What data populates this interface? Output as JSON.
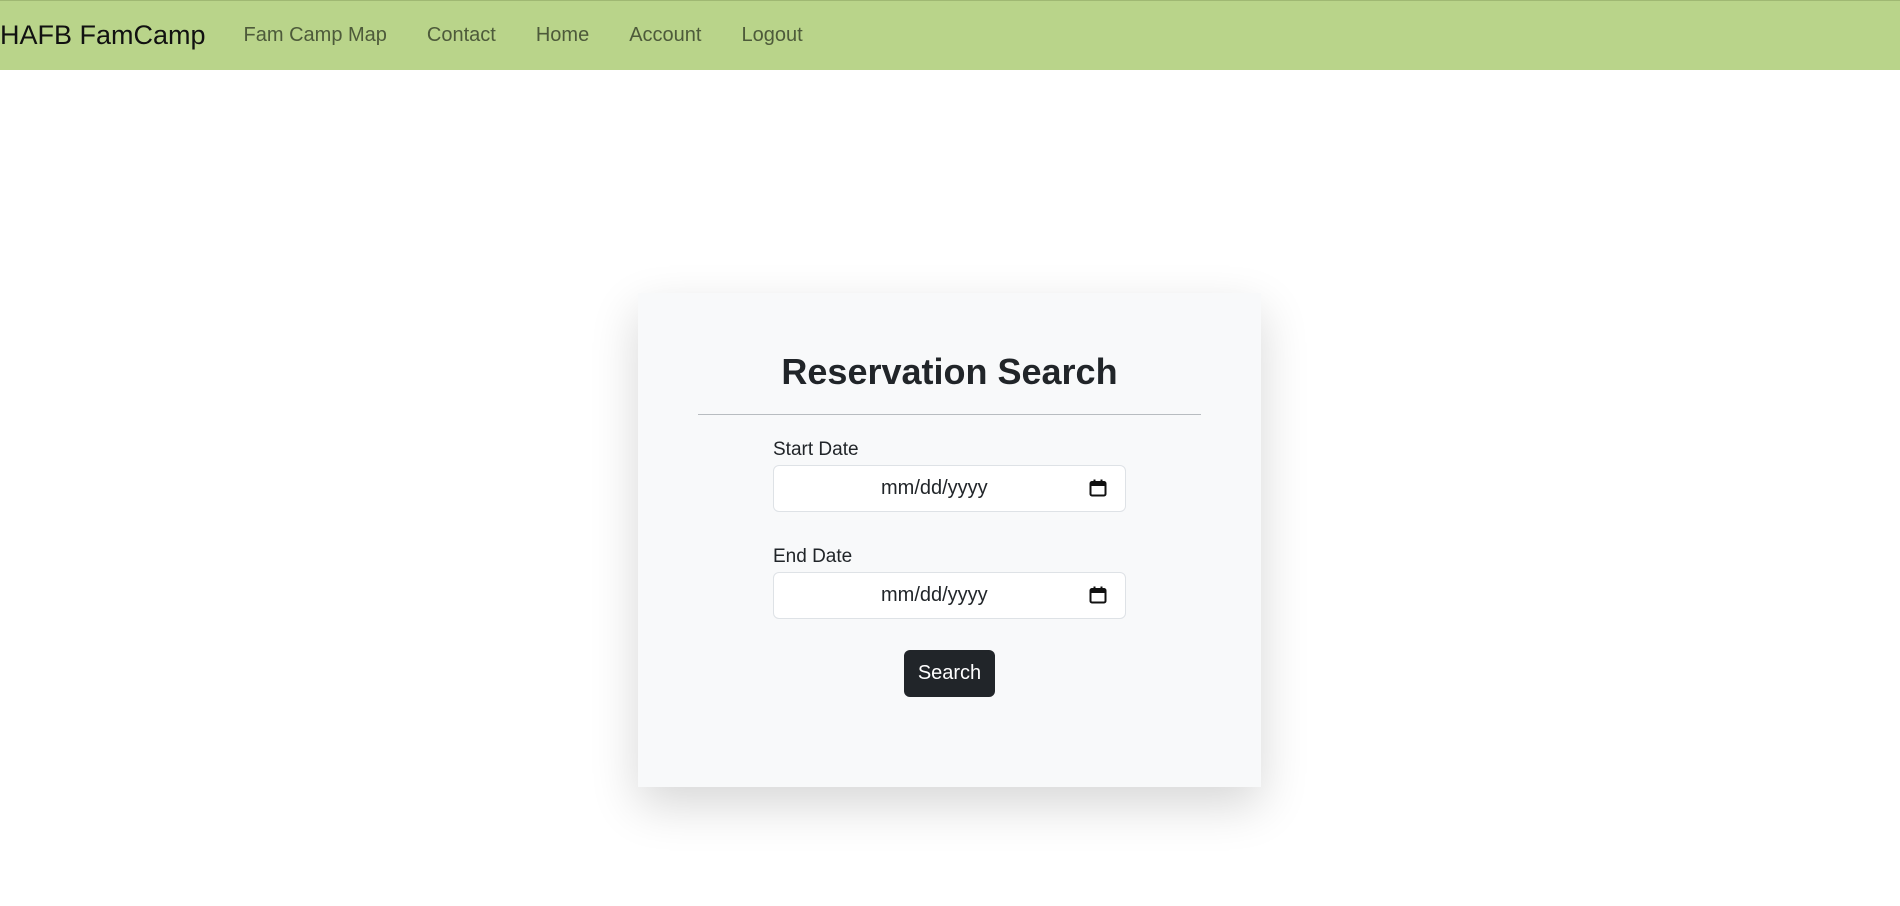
{
  "navbar": {
    "brand": "HAFB FamCamp",
    "links": [
      {
        "label": "Fam Camp Map"
      },
      {
        "label": "Contact"
      },
      {
        "label": "Home"
      },
      {
        "label": "Account"
      },
      {
        "label": "Logout"
      }
    ],
    "background_color": "#b9d48a"
  },
  "form": {
    "title": "Reservation Search",
    "start_date": {
      "label": "Start Date",
      "placeholder": "mm/dd/yyyy",
      "value": "",
      "icon": "calendar-icon"
    },
    "end_date": {
      "label": "End Date",
      "placeholder": "mm/dd/yyyy",
      "value": "",
      "icon": "calendar-icon"
    },
    "submit_label": "Search",
    "button_color": "#212529",
    "card_color": "#f8f9fa"
  }
}
